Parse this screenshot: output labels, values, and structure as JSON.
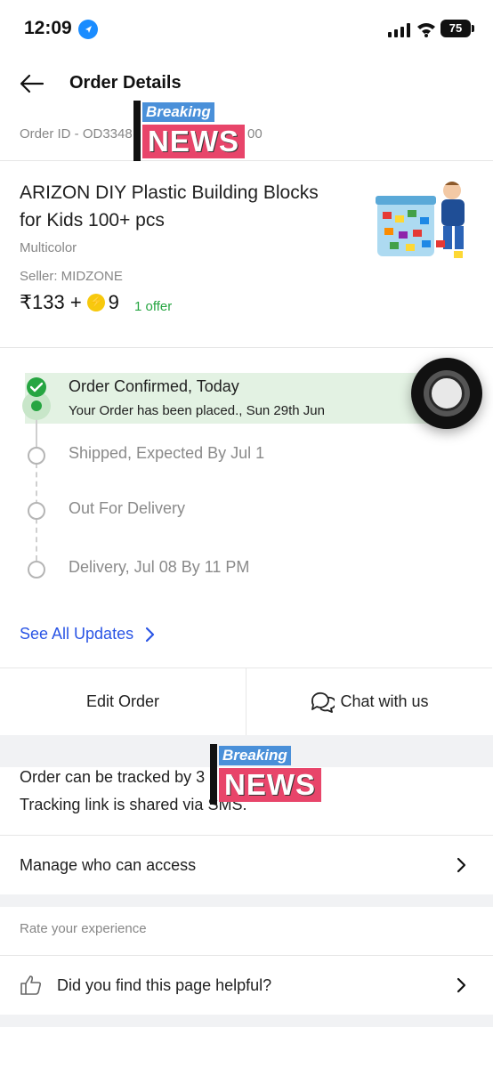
{
  "status_bar": {
    "time": "12:09",
    "battery": "75"
  },
  "header": {
    "title": "Order Details",
    "order_id": "Order ID - OD3348",
    "order_id_tail": "00"
  },
  "product": {
    "name": "ARIZON DIY Plastic Building Blocks for Kids 100+ pcs",
    "color": "Multicolor",
    "seller": "Seller: MIDZONE",
    "price": "₹133 +",
    "supercoins": "9",
    "offer": "1 offer"
  },
  "timeline": [
    {
      "title": "Order Confirmed, Today",
      "subtitle": "Your Order has been placed., Sun 29th Jun",
      "done": true
    },
    {
      "title": "Shipped, Expected By Jul 1",
      "done": false
    },
    {
      "title": "Out For Delivery",
      "done": false
    },
    {
      "title": "Delivery, Jul 08 By 11 PM",
      "done": false
    }
  ],
  "see_all": "See All Updates",
  "actions": {
    "edit": "Edit Order",
    "chat": "Chat with us"
  },
  "tracking": {
    "line1": "Order can be tracked by",
    "line1_tail": "3",
    "line2": "Tracking link is shared via",
    "line2_tail": "SMS."
  },
  "manage_access": "Manage who can access",
  "rate_heading": "Rate your experience",
  "helpful": "Did you find this page helpful?",
  "overlays": [
    {
      "top": "Breaking",
      "main": "NEWS"
    },
    {
      "top": "Breaking",
      "main": "NEWS"
    }
  ],
  "colors": {
    "success": "#26a541",
    "link": "#2a55e5",
    "news_blue": "#4a90d9",
    "news_pink": "#e8456a"
  }
}
